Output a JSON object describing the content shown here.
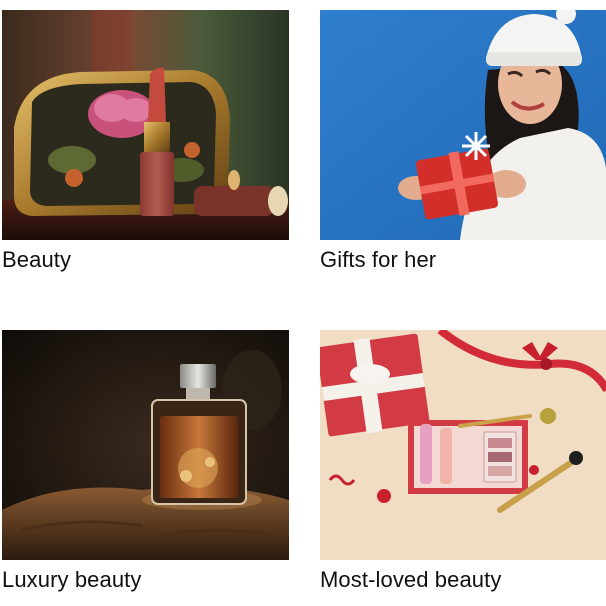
{
  "tiles": [
    {
      "label": "Beauty",
      "image": "cosmetic-pouch-lipstick-image"
    },
    {
      "label": "Gifts for her",
      "image": "woman-holding-gift-image"
    },
    {
      "label": "Luxury beauty",
      "image": "perfume-bottle-image"
    },
    {
      "label": "Most-loved beauty",
      "image": "makeup-gift-box-image"
    }
  ]
}
